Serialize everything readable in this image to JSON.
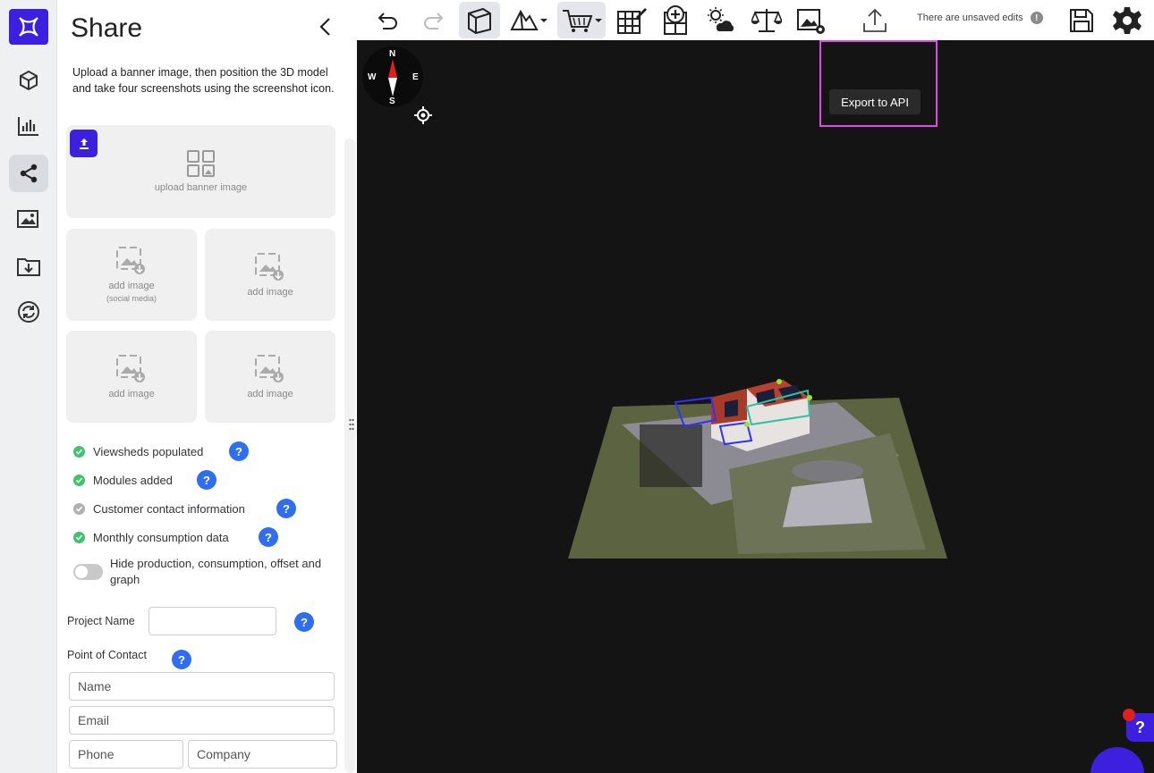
{
  "panel": {
    "title": "Share",
    "description": "Upload a banner image, then position the 3D model and take four screenshots using the screenshot icon.",
    "banner_tile": {
      "label": "upload banner image"
    },
    "image_tiles": [
      {
        "label": "add image",
        "sub": "(social media)"
      },
      {
        "label": "add image",
        "sub": ""
      },
      {
        "label": "add image",
        "sub": ""
      },
      {
        "label": "add image",
        "sub": ""
      }
    ],
    "checklist": [
      {
        "label": "Viewsheds populated",
        "status": "done"
      },
      {
        "label": "Modules added",
        "status": "done"
      },
      {
        "label": "Customer contact information",
        "status": "pending"
      },
      {
        "label": "Monthly consumption data",
        "status": "done"
      }
    ],
    "toggle": {
      "label": "Hide production, consumption, offset and graph",
      "on": false
    },
    "project_name": {
      "label": "Project Name",
      "value": ""
    },
    "point_of_contact": {
      "label": "Point of Contact",
      "name_placeholder": "Name",
      "email_placeholder": "Email",
      "phone_placeholder": "Phone",
      "company_placeholder": "Company"
    },
    "help_glyph": "?"
  },
  "toolbar": {
    "unsaved_text": "There are unsaved edits",
    "unsaved_badge": "!",
    "tooltip": "Export to API"
  },
  "compass": {
    "n": "N",
    "s": "S",
    "e": "E",
    "w": "W"
  },
  "chat": {
    "help_glyph": "?"
  },
  "colors": {
    "brand": "#3d1fe0",
    "help": "#2f6fef",
    "check_done": "#3ec46d",
    "check_pending": "#b0b0b0",
    "highlight": "#e048e8"
  }
}
